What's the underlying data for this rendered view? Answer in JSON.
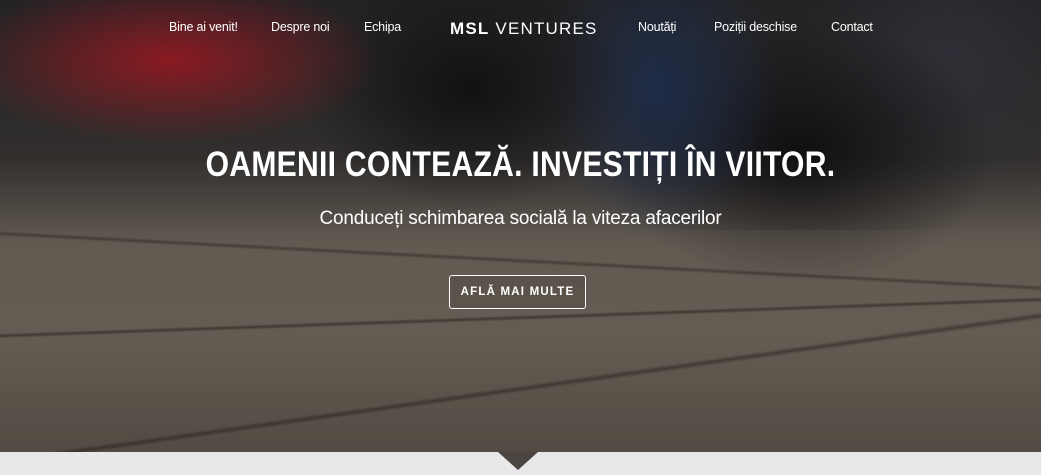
{
  "nav": {
    "left_items": [
      "Bine ai venit!",
      "Despre noi",
      "Echipa"
    ],
    "right_items": [
      "Noutăți",
      "Poziții deschise",
      "Contact"
    ],
    "logo_bold": "MSL",
    "logo_light": "VENTURES"
  },
  "hero": {
    "headline": "OAMENII CONTEAZĂ. INVESTIȚI ÎN VIITOR.",
    "subline": "Conduceți schimbarea socială la viteza afacerilor",
    "cta_label": "AFLĂ MAI MULTE"
  },
  "icons": {
    "scroll_indicator": "triangle-down-icon"
  }
}
